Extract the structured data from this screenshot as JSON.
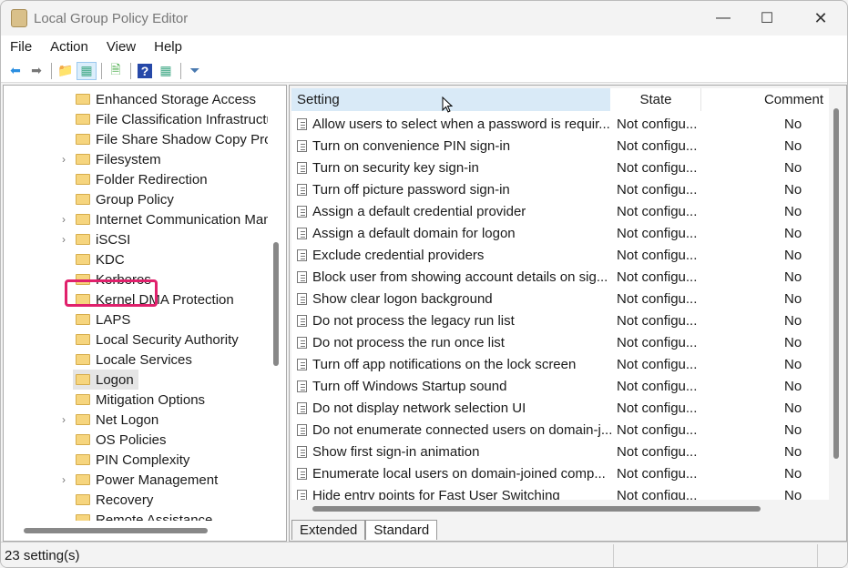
{
  "window": {
    "title": "Local Group Policy Editor",
    "controls": [
      "minimize",
      "maximize",
      "close"
    ]
  },
  "menu": [
    "File",
    "Action",
    "View",
    "Help"
  ],
  "toolbar": [
    "back-icon",
    "forward-icon",
    "up-folder-icon",
    "show-hide-tree-icon",
    "export-list-icon",
    "help-icon",
    "show-action-pane-icon",
    "filter-icon"
  ],
  "tree": [
    {
      "label": "Enhanced Storage Access",
      "expandable": false
    },
    {
      "label": "File Classification Infrastructure",
      "expandable": false
    },
    {
      "label": "File Share Shadow Copy Provider",
      "expandable": false
    },
    {
      "label": "Filesystem",
      "expandable": true
    },
    {
      "label": "Folder Redirection",
      "expandable": false
    },
    {
      "label": "Group Policy",
      "expandable": false
    },
    {
      "label": "Internet Communication Management",
      "expandable": true
    },
    {
      "label": "iSCSI",
      "expandable": true
    },
    {
      "label": "KDC",
      "expandable": false
    },
    {
      "label": "Kerberos",
      "expandable": false
    },
    {
      "label": "Kernel DMA Protection",
      "expandable": false
    },
    {
      "label": "LAPS",
      "expandable": false
    },
    {
      "label": "Local Security Authority",
      "expandable": false
    },
    {
      "label": "Locale Services",
      "expandable": false
    },
    {
      "label": "Logon",
      "expandable": false,
      "selected": true
    },
    {
      "label": "Mitigation Options",
      "expandable": false
    },
    {
      "label": "Net Logon",
      "expandable": true
    },
    {
      "label": "OS Policies",
      "expandable": false
    },
    {
      "label": "PIN Complexity",
      "expandable": false
    },
    {
      "label": "Power Management",
      "expandable": true
    },
    {
      "label": "Recovery",
      "expandable": false
    },
    {
      "label": "Remote Assistance",
      "expandable": false
    }
  ],
  "list": {
    "columns": [
      "Setting",
      "State",
      "Comment"
    ],
    "rows": [
      [
        "Allow users to select when a password is requir...",
        "Not configu...",
        "No"
      ],
      [
        "Turn on convenience PIN sign-in",
        "Not configu...",
        "No"
      ],
      [
        "Turn on security key sign-in",
        "Not configu...",
        "No"
      ],
      [
        "Turn off picture password sign-in",
        "Not configu...",
        "No"
      ],
      [
        "Assign a default credential provider",
        "Not configu...",
        "No"
      ],
      [
        "Assign a default domain for logon",
        "Not configu...",
        "No"
      ],
      [
        "Exclude credential providers",
        "Not configu...",
        "No"
      ],
      [
        "Block user from showing account details on sig...",
        "Not configu...",
        "No"
      ],
      [
        "Show clear logon background",
        "Not configu...",
        "No"
      ],
      [
        "Do not process the legacy run list",
        "Not configu...",
        "No"
      ],
      [
        "Do not process the run once list",
        "Not configu...",
        "No"
      ],
      [
        "Turn off app notifications on the lock screen",
        "Not configu...",
        "No"
      ],
      [
        "Turn off Windows Startup sound",
        "Not configu...",
        "No"
      ],
      [
        "Do not display network selection UI",
        "Not configu...",
        "No"
      ],
      [
        "Do not enumerate connected users on domain-j...",
        "Not configu...",
        "No"
      ],
      [
        "Show first sign-in animation",
        "Not configu...",
        "No"
      ],
      [
        "Enumerate local users on domain-joined comp...",
        "Not configu...",
        "No"
      ],
      [
        "Hide entry points for Fast User Switching",
        "Not configu...",
        "No"
      ]
    ]
  },
  "tabs": [
    {
      "label": "Extended",
      "active": false
    },
    {
      "label": "Standard",
      "active": true
    }
  ],
  "status": {
    "text": "23 setting(s)"
  },
  "colors": {
    "highlight": "#e0216c",
    "header_hover": "#d9eaf7"
  }
}
